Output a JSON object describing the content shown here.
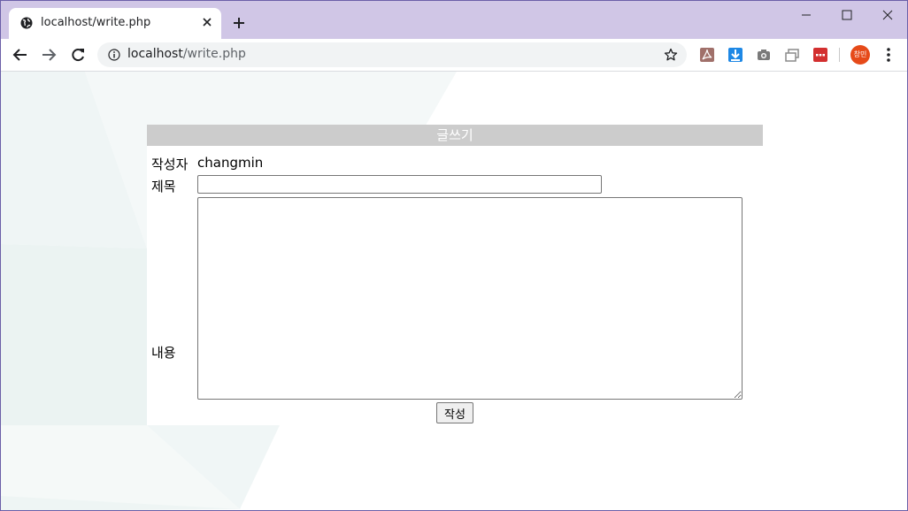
{
  "browser": {
    "tab": {
      "title": "localhost/write.php"
    },
    "address": {
      "host": "localhost",
      "path": "/write.php"
    },
    "profile": {
      "avatar_text": "창민"
    }
  },
  "form": {
    "header": "글쓰기",
    "author_label": "작성자",
    "author_value": "changmin",
    "title_label": "제목",
    "title_value": "",
    "content_label": "내용",
    "content_value": "",
    "submit_label": "작성"
  }
}
